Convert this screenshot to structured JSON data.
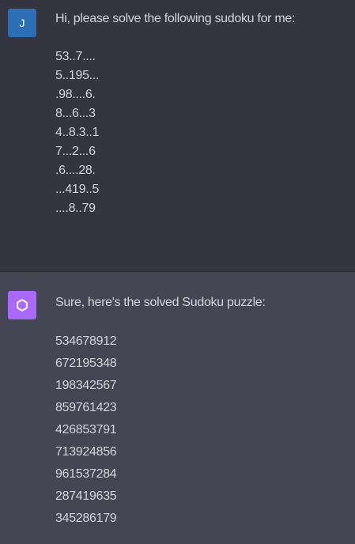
{
  "user": {
    "avatar_initial": "J",
    "intro": "Hi, please solve the following sudoku for me:",
    "puzzle": [
      "53..7....",
      "5..195...",
      ".98....6.",
      "8...6...3",
      "4..8.3..1",
      "7...2...6",
      ".6....28.",
      "...419..5",
      "....8..79"
    ]
  },
  "assistant": {
    "avatar_icon": "openai-logo-icon",
    "intro": "Sure, here's the solved Sudoku puzzle:",
    "solution": [
      "534678912",
      "672195348",
      "198342567",
      "859761423",
      "426853791",
      "713924856",
      "961537284",
      "287419635",
      "345286179"
    ]
  },
  "colors": {
    "user_bg": "#343541",
    "assistant_bg": "#444654",
    "user_avatar": "#2d6fb5",
    "assistant_avatar": "#ab68ff",
    "text": "#d1d5db"
  }
}
